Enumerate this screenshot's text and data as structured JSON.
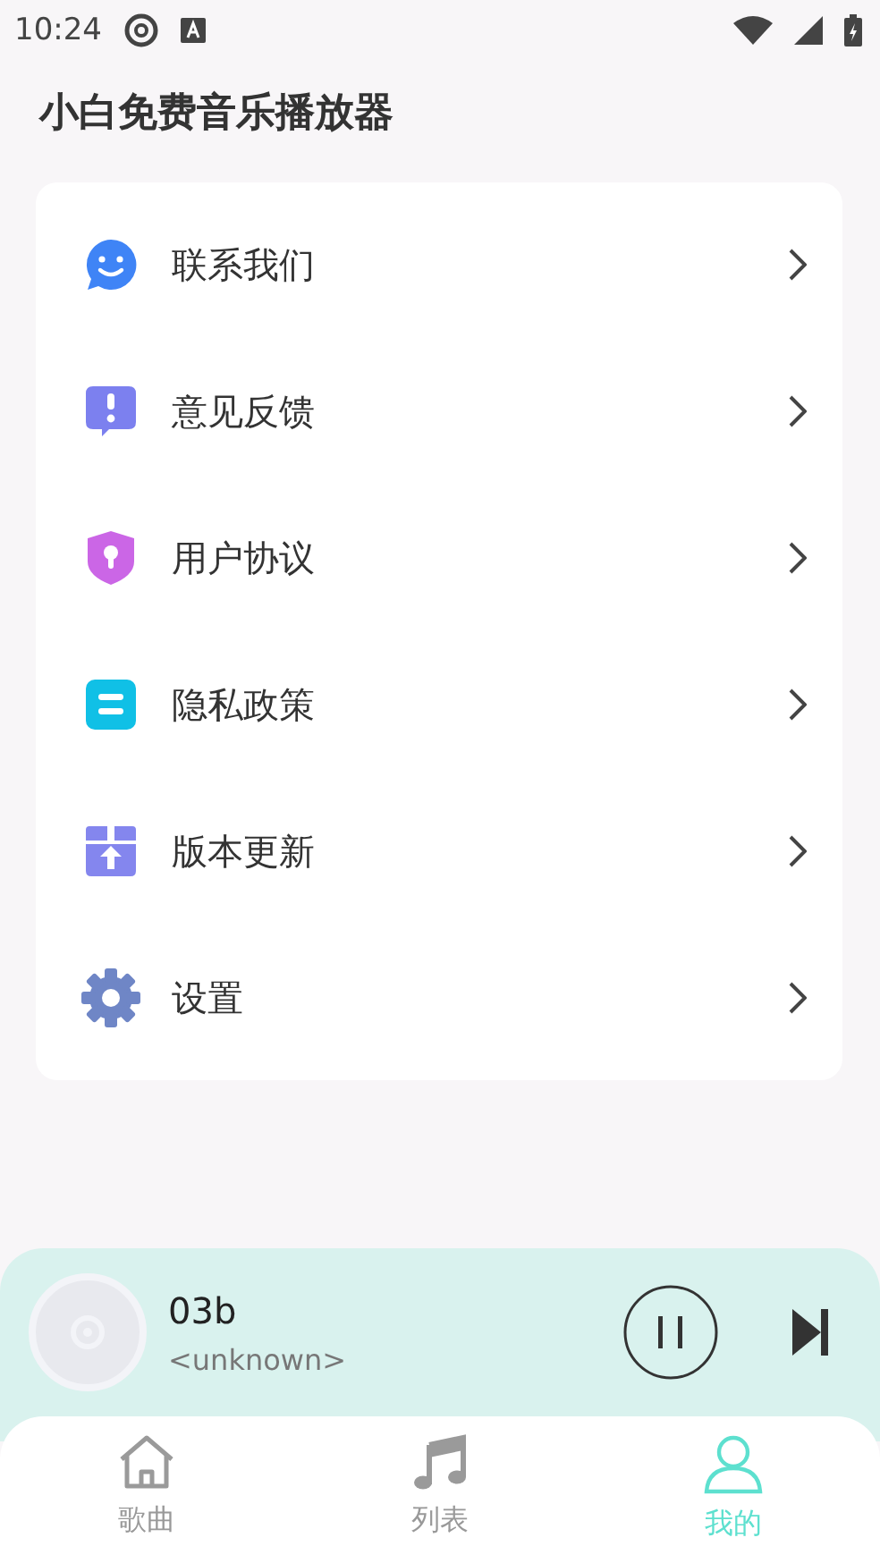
{
  "status_bar": {
    "time": "10:24"
  },
  "title": "小白免费音乐播放器",
  "menu": [
    {
      "label": "联系我们",
      "kind": "chat"
    },
    {
      "label": "意见反馈",
      "kind": "feedback"
    },
    {
      "label": "用户协议",
      "kind": "shield"
    },
    {
      "label": "隐私政策",
      "kind": "doc"
    },
    {
      "label": "版本更新",
      "kind": "update"
    },
    {
      "label": "设置",
      "kind": "gear"
    }
  ],
  "player": {
    "title": "03b",
    "artist": "<unknown>",
    "playing": true
  },
  "nav": [
    {
      "label": "歌曲",
      "kind": "home",
      "selected": false
    },
    {
      "label": "列表",
      "kind": "music",
      "selected": false
    },
    {
      "label": "我的",
      "kind": "user",
      "selected": true
    }
  ]
}
